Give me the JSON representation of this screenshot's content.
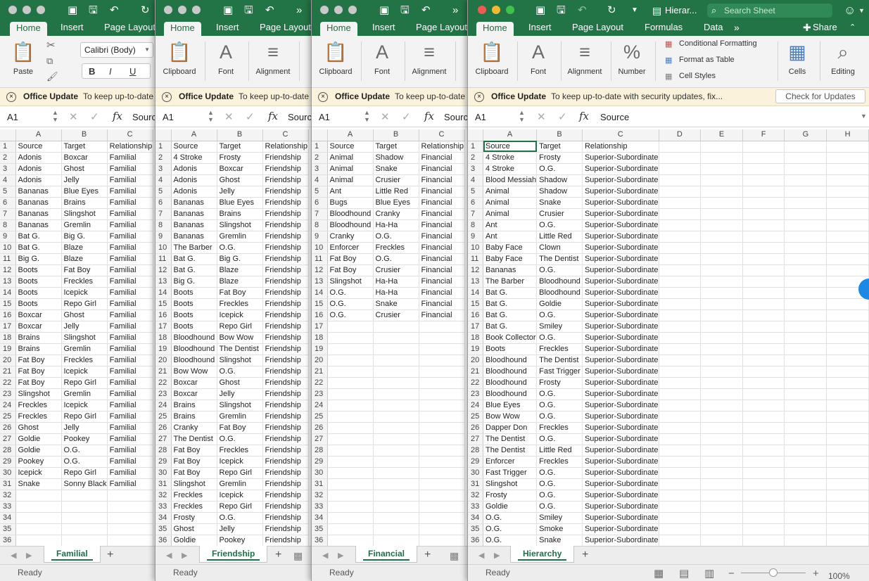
{
  "tabs": {
    "home": "Home",
    "insert": "Insert",
    "page_layout": "Page Layout",
    "formulas": "Formulas",
    "data": "Data",
    "share": "Share"
  },
  "search": {
    "placeholder": "Search Sheet"
  },
  "window_title": "Hierar...",
  "ribbon": {
    "paste": "Paste",
    "clipboard": "Clipboard",
    "font": "Font",
    "alignment": "Alignment",
    "number": "Number",
    "cells": "Cells",
    "editing": "Editing",
    "font_name": "Calibri (Body)",
    "bold": "B",
    "italic": "I",
    "underline": "U",
    "cond_format": "Conditional Formatting",
    "format_table": "Format as Table",
    "cell_styles": "Cell Styles"
  },
  "update": {
    "title": "Office Update",
    "message": "To keep up-to-date with security updates, fix...",
    "button": "Check for Updates"
  },
  "formula": {
    "namebox": "A1",
    "content": "Source"
  },
  "status": {
    "ready": "Ready",
    "zoom": "100%"
  },
  "windows": [
    {
      "sheet_tab": "Familial",
      "rel": "Familial",
      "rows": [
        [
          "Adonis",
          "Boxcar"
        ],
        [
          "Adonis",
          "Ghost"
        ],
        [
          "Adonis",
          "Jelly"
        ],
        [
          "Bananas",
          "Blue Eyes"
        ],
        [
          "Bananas",
          "Brains"
        ],
        [
          "Bananas",
          "Slingshot"
        ],
        [
          "Bananas",
          "Gremlin"
        ],
        [
          "Bat G.",
          "Big G."
        ],
        [
          "Bat G.",
          "Blaze"
        ],
        [
          "Big G.",
          "Blaze"
        ],
        [
          "Boots",
          "Fat Boy"
        ],
        [
          "Boots",
          "Freckles"
        ],
        [
          "Boots",
          "Icepick"
        ],
        [
          "Boots",
          "Repo Girl"
        ],
        [
          "Boxcar",
          "Ghost"
        ],
        [
          "Boxcar",
          "Jelly"
        ],
        [
          "Brains",
          "Slingshot"
        ],
        [
          "Brains",
          "Gremlin"
        ],
        [
          "Fat Boy",
          "Freckles"
        ],
        [
          "Fat Boy",
          "Icepick"
        ],
        [
          "Fat Boy",
          "Repo Girl"
        ],
        [
          "Slingshot",
          "Gremlin"
        ],
        [
          "Freckles",
          "Icepick"
        ],
        [
          "Freckles",
          "Repo Girl"
        ],
        [
          "Ghost",
          "Jelly"
        ],
        [
          "Goldie",
          "Pookey"
        ],
        [
          "Goldie",
          "O.G."
        ],
        [
          "Pookey",
          "O.G."
        ],
        [
          "Icepick",
          "Repo Girl"
        ],
        [
          "Snake",
          "Sonny Black"
        ]
      ]
    },
    {
      "sheet_tab": "Friendship",
      "rel": "Friendship",
      "rows": [
        [
          "4 Stroke",
          "Frosty"
        ],
        [
          "Adonis",
          "Boxcar"
        ],
        [
          "Adonis",
          "Ghost"
        ],
        [
          "Adonis",
          "Jelly"
        ],
        [
          "Bananas",
          "Blue Eyes"
        ],
        [
          "Bananas",
          "Brains"
        ],
        [
          "Bananas",
          "Slingshot"
        ],
        [
          "Bananas",
          "Gremlin"
        ],
        [
          "The Barber",
          "O.G."
        ],
        [
          "Bat G.",
          "Big G."
        ],
        [
          "Bat G.",
          "Blaze"
        ],
        [
          "Big G.",
          "Blaze"
        ],
        [
          "Boots",
          "Fat Boy"
        ],
        [
          "Boots",
          "Freckles"
        ],
        [
          "Boots",
          "Icepick"
        ],
        [
          "Boots",
          "Repo Girl"
        ],
        [
          "Bloodhound",
          "Bow Wow"
        ],
        [
          "Bloodhound",
          "The Dentist"
        ],
        [
          "Bloodhound",
          "Slingshot"
        ],
        [
          "Bow Wow",
          "O.G."
        ],
        [
          "Boxcar",
          "Ghost"
        ],
        [
          "Boxcar",
          "Jelly"
        ],
        [
          "Brains",
          "Slingshot"
        ],
        [
          "Brains",
          "Gremlin"
        ],
        [
          "Cranky",
          "Fat Boy"
        ],
        [
          "The Dentist",
          "O.G."
        ],
        [
          "Fat Boy",
          "Freckles"
        ],
        [
          "Fat Boy",
          "Icepick"
        ],
        [
          "Fat Boy",
          "Repo Girl"
        ],
        [
          "Slingshot",
          "Gremlin"
        ],
        [
          "Freckles",
          "Icepick"
        ],
        [
          "Freckles",
          "Repo Girl"
        ],
        [
          "Frosty",
          "O.G."
        ],
        [
          "Ghost",
          "Jelly"
        ],
        [
          "Goldie",
          "Pookey"
        ]
      ]
    },
    {
      "sheet_tab": "Financial",
      "rel": "Financial",
      "rows": [
        [
          "Animal",
          "Shadow"
        ],
        [
          "Animal",
          "Snake"
        ],
        [
          "Animal",
          "Crusier"
        ],
        [
          "Ant",
          "Little Red"
        ],
        [
          "Bugs",
          "Blue Eyes"
        ],
        [
          "Bloodhound",
          "Cranky"
        ],
        [
          "Bloodhound",
          "Ha-Ha"
        ],
        [
          "Cranky",
          "O.G."
        ],
        [
          "Enforcer",
          "Freckles"
        ],
        [
          "Fat Boy",
          "O.G."
        ],
        [
          "Fat Boy",
          "Crusier"
        ],
        [
          "Slingshot",
          "Ha-Ha"
        ],
        [
          "O.G.",
          "Ha-Ha"
        ],
        [
          "O.G.",
          "Snake"
        ],
        [
          "O.G.",
          "Crusier"
        ]
      ]
    },
    {
      "sheet_tab": "Hierarchy",
      "rel": "Superior-Subordinate",
      "rows": [
        [
          "4 Stroke",
          "Frosty"
        ],
        [
          "4 Stroke",
          "O.G."
        ],
        [
          "Blood Messiah",
          "Shadow"
        ],
        [
          "Animal",
          "Shadow"
        ],
        [
          "Animal",
          "Snake"
        ],
        [
          "Animal",
          "Crusier"
        ],
        [
          "Ant",
          "O.G."
        ],
        [
          "Ant",
          "Little Red"
        ],
        [
          "Baby Face",
          "Clown"
        ],
        [
          "Baby Face",
          "The Dentist"
        ],
        [
          "Bananas",
          "O.G."
        ],
        [
          "The Barber",
          "Bloodhound"
        ],
        [
          "Bat G.",
          "Bloodhound"
        ],
        [
          "Bat G.",
          "Goldie"
        ],
        [
          "Bat G.",
          "O.G."
        ],
        [
          "Bat G.",
          "Smiley"
        ],
        [
          "Book Collector",
          "O.G."
        ],
        [
          "Boots",
          "Freckles"
        ],
        [
          "Bloodhound",
          "The Dentist"
        ],
        [
          "Bloodhound",
          "Fast Trigger"
        ],
        [
          "Bloodhound",
          "Frosty"
        ],
        [
          "Bloodhound",
          "O.G."
        ],
        [
          "Blue Eyes",
          "O.G."
        ],
        [
          "Bow Wow",
          "O.G."
        ],
        [
          "Dapper Don",
          "Freckles"
        ],
        [
          "The Dentist",
          "O.G."
        ],
        [
          "The Dentist",
          "Little Red"
        ],
        [
          "Enforcer",
          "Freckles"
        ],
        [
          "Fast Trigger",
          "O.G."
        ],
        [
          "Slingshot",
          "O.G."
        ],
        [
          "Frosty",
          "O.G."
        ],
        [
          "Goldie",
          "O.G."
        ],
        [
          "O.G.",
          "Smiley"
        ],
        [
          "O.G.",
          "Smoke"
        ],
        [
          "O.G.",
          "Snake"
        ]
      ]
    }
  ],
  "header": {
    "source": "Source",
    "target": "Target",
    "relationship": "Relationship"
  },
  "cols": [
    "A",
    "B",
    "C",
    "D",
    "E",
    "F",
    "G",
    "H"
  ]
}
